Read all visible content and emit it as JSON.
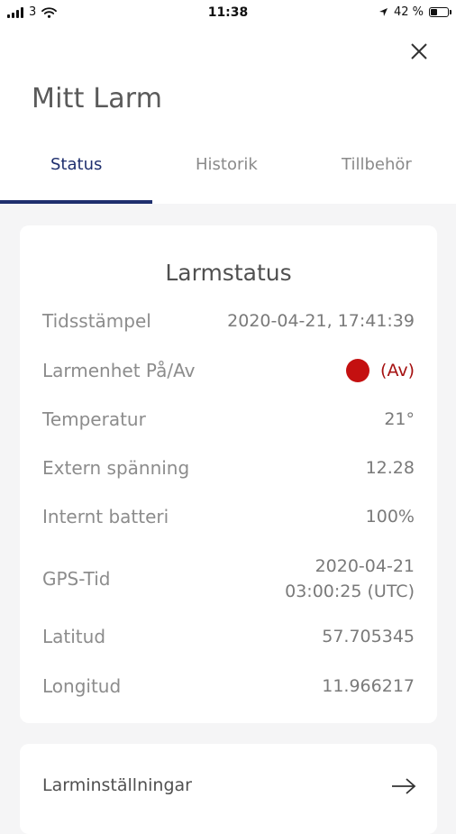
{
  "status_bar": {
    "carrier": "3",
    "time": "11:38",
    "battery_percent": "42 %",
    "battery_level": 0.42
  },
  "header": {
    "title": "Mitt Larm",
    "tabs": [
      {
        "label": "Status",
        "active": true
      },
      {
        "label": "Historik",
        "active": false
      },
      {
        "label": "Tillbehör",
        "active": false
      }
    ]
  },
  "alarm_status": {
    "title": "Larmstatus",
    "rows": [
      {
        "label": "Tidsstämpel",
        "value": "2020-04-21, 17:41:39"
      },
      {
        "label": "Larmenhet På/Av",
        "value": "(Av)",
        "indicator_color": "#c41010"
      },
      {
        "label": "Temperatur",
        "value": "21°"
      },
      {
        "label": "Extern spänning",
        "value": "12.28"
      },
      {
        "label": "Internt batteri",
        "value": "100%"
      },
      {
        "label": "GPS-Tid",
        "value_line1": "2020-04-21",
        "value_line2": "03:00:25 (UTC)"
      },
      {
        "label": "Latitud",
        "value": "57.705345"
      },
      {
        "label": "Longitud",
        "value": "11.966217"
      }
    ]
  },
  "settings_link": {
    "label": "Larminställningar",
    "icon": "arrow-right-icon"
  },
  "colors": {
    "accent": "#1f2f6e",
    "alarm_red": "#c41010"
  }
}
